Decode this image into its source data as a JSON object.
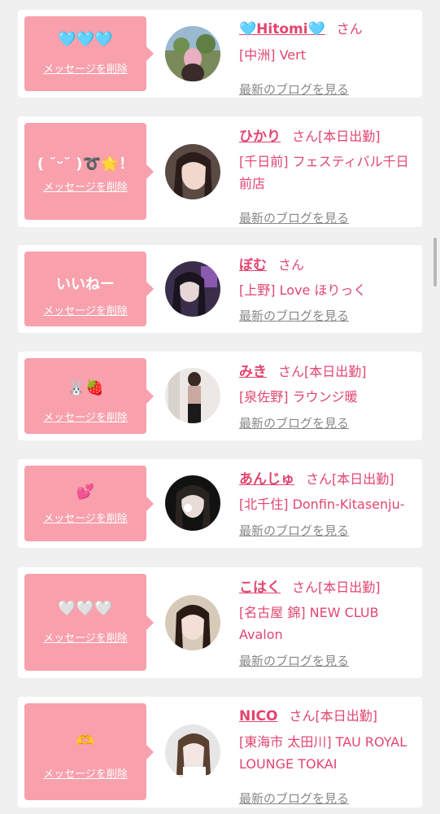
{
  "accent_color": "#e2456f",
  "bubble_color": "#f8a0ac",
  "delete_label": "メッセージを削除",
  "blog_label": "最新のブログを見る",
  "san_label": "さん",
  "cards": [
    {
      "message": "🩵🩵🩵",
      "name": "🩵Hitomi🩵",
      "tag": "",
      "shop": "[中洲] Vert"
    },
    {
      "message": "( ˘ᵕ˘ )➰🌟！",
      "name": "ひかり",
      "tag": "[本日出勤]",
      "shop": "[千日前] フェスティバル千日前店"
    },
    {
      "message": "いいねー",
      "name": "ぼむ",
      "tag": "",
      "shop": "[上野] Love ほりっく"
    },
    {
      "message": "🐰🍓",
      "name": "みき",
      "tag": "[本日出勤]",
      "shop": "[泉佐野] ラウンジ暖"
    },
    {
      "message": "💕",
      "name": "あんじゅ",
      "tag": "[本日出勤]",
      "shop": "[北千住] Donfin-Kitasenju-"
    },
    {
      "message": "🤍🤍🤍",
      "name": "こはく",
      "tag": "[本日出勤]",
      "shop": "[名古屋 錦] NEW CLUB Avalon"
    },
    {
      "message": "🫶",
      "name": "NICO",
      "tag": "[本日出勤]",
      "shop": "[東海市 太田川] TAU ROYAL LOUNGE TOKAI"
    }
  ]
}
